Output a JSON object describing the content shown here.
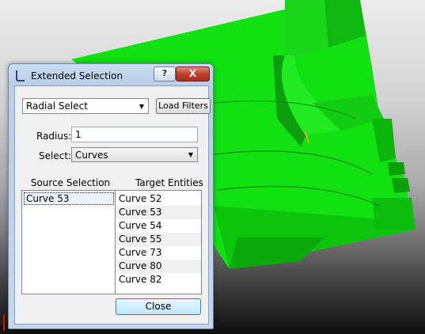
{
  "dialog": {
    "title": "Extended Selection",
    "help_label": "?",
    "close_x_label": "X"
  },
  "mode": {
    "selected": "Radial Select"
  },
  "load_filters_label": "Load Filters",
  "radius": {
    "label": "Radius:",
    "value": "1"
  },
  "select": {
    "label": "Select:",
    "selected": "Curves"
  },
  "source": {
    "heading": "Source Selection",
    "items": [
      "Curve 53"
    ]
  },
  "target": {
    "heading": "Target Entities",
    "items": [
      "Curve 52",
      "Curve 53",
      "Curve 54",
      "Curve 55",
      "Curve 73",
      "Curve 80",
      "Curve 82"
    ]
  },
  "close_label": "Close",
  "colors": {
    "model": "#00e000",
    "model_dark": "#00a800",
    "accent": "#3c7fb1"
  }
}
